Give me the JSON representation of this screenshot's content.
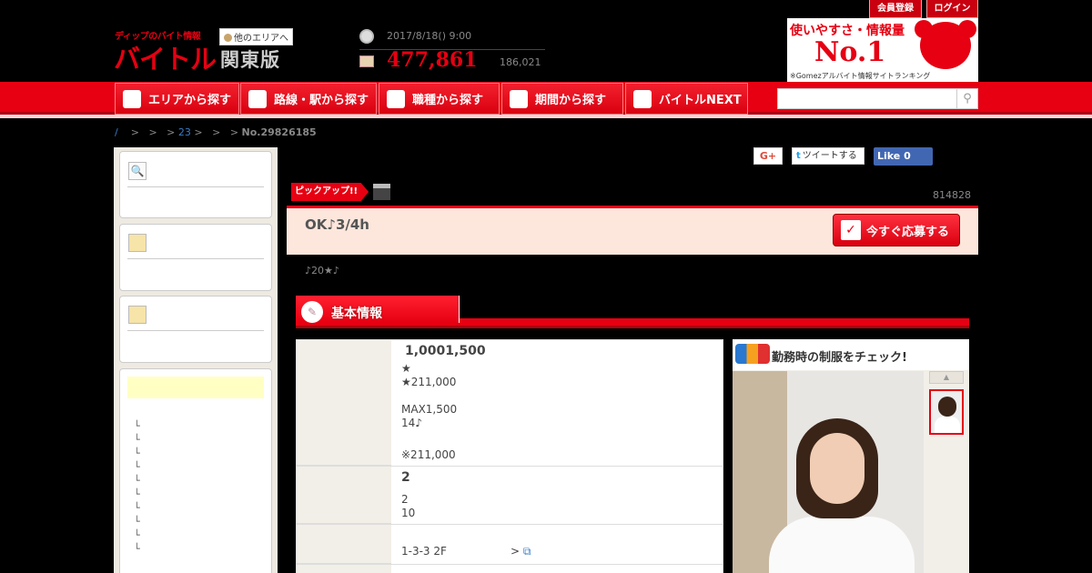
{
  "header": {
    "logo_tagline": "ディップのバイト情報",
    "logo_name": "バイトル",
    "other_area_link": "他のエリアへ",
    "area_name": "関東版",
    "date_time": "2017/8/18() 9:00",
    "total_jobs": "477,861",
    "new_jobs": "186,021",
    "member_register_label": "会員登録",
    "login_label": "ログイン",
    "banner": {
      "line1": "使いやすさ・情報量",
      "line2": "No.1",
      "line3": "※Gomezアルバイト情報サイトランキング"
    }
  },
  "nav": {
    "items": [
      {
        "label": "エリアから探す",
        "icon": "map-icon"
      },
      {
        "label": "路線・駅から探す",
        "icon": "train-icon"
      },
      {
        "label": "職種から探す",
        "icon": "person-icon"
      },
      {
        "label": "期間から探す",
        "icon": "calendar-icon"
      },
      {
        "label": "バイトルNEXT",
        "icon": "pencil-icon"
      }
    ],
    "search_placeholder": "",
    "search_icon": "search-icon"
  },
  "breadcrumb": {
    "root": "/",
    "sep1": ">",
    "sep2": ">",
    "sep3": ">",
    "link_23": "23",
    "sep4": ">",
    "sep5": ">",
    "sep6": ">",
    "current": "No.29826185"
  },
  "sidebar": {
    "tree_marks": [
      "└",
      "└",
      "└",
      "└",
      "└",
      "└",
      "└",
      "└",
      "└",
      "└"
    ]
  },
  "share": {
    "gplus_label": "G+",
    "tweet_label": "ツイートする",
    "tweet_bird": "t",
    "like_label": "Like 0"
  },
  "job": {
    "pickup_label": "ピックアップ!!",
    "job_id": "814828",
    "title": "OK♪3/4h",
    "apply_label": "今すぐ応募する",
    "apply_check": "✓",
    "catch": "♪20★♪"
  },
  "basic_info": {
    "section_title": "基本情報",
    "salary": {
      "headline": "1,0001,500",
      "lines": [
        "★",
        "★211,000",
        "",
        "MAX1,500",
        "14♪",
        "",
        "※211,000"
      ]
    },
    "schedule": {
      "headline": "2",
      "lines": [
        "2",
        "10"
      ]
    },
    "location": {
      "address": "1-3-3 2F",
      "map_link": ">",
      "map_icon": "⧉"
    }
  },
  "uniform": {
    "title": "勤務時の制服をチェック!",
    "up_arrow": "▲"
  }
}
